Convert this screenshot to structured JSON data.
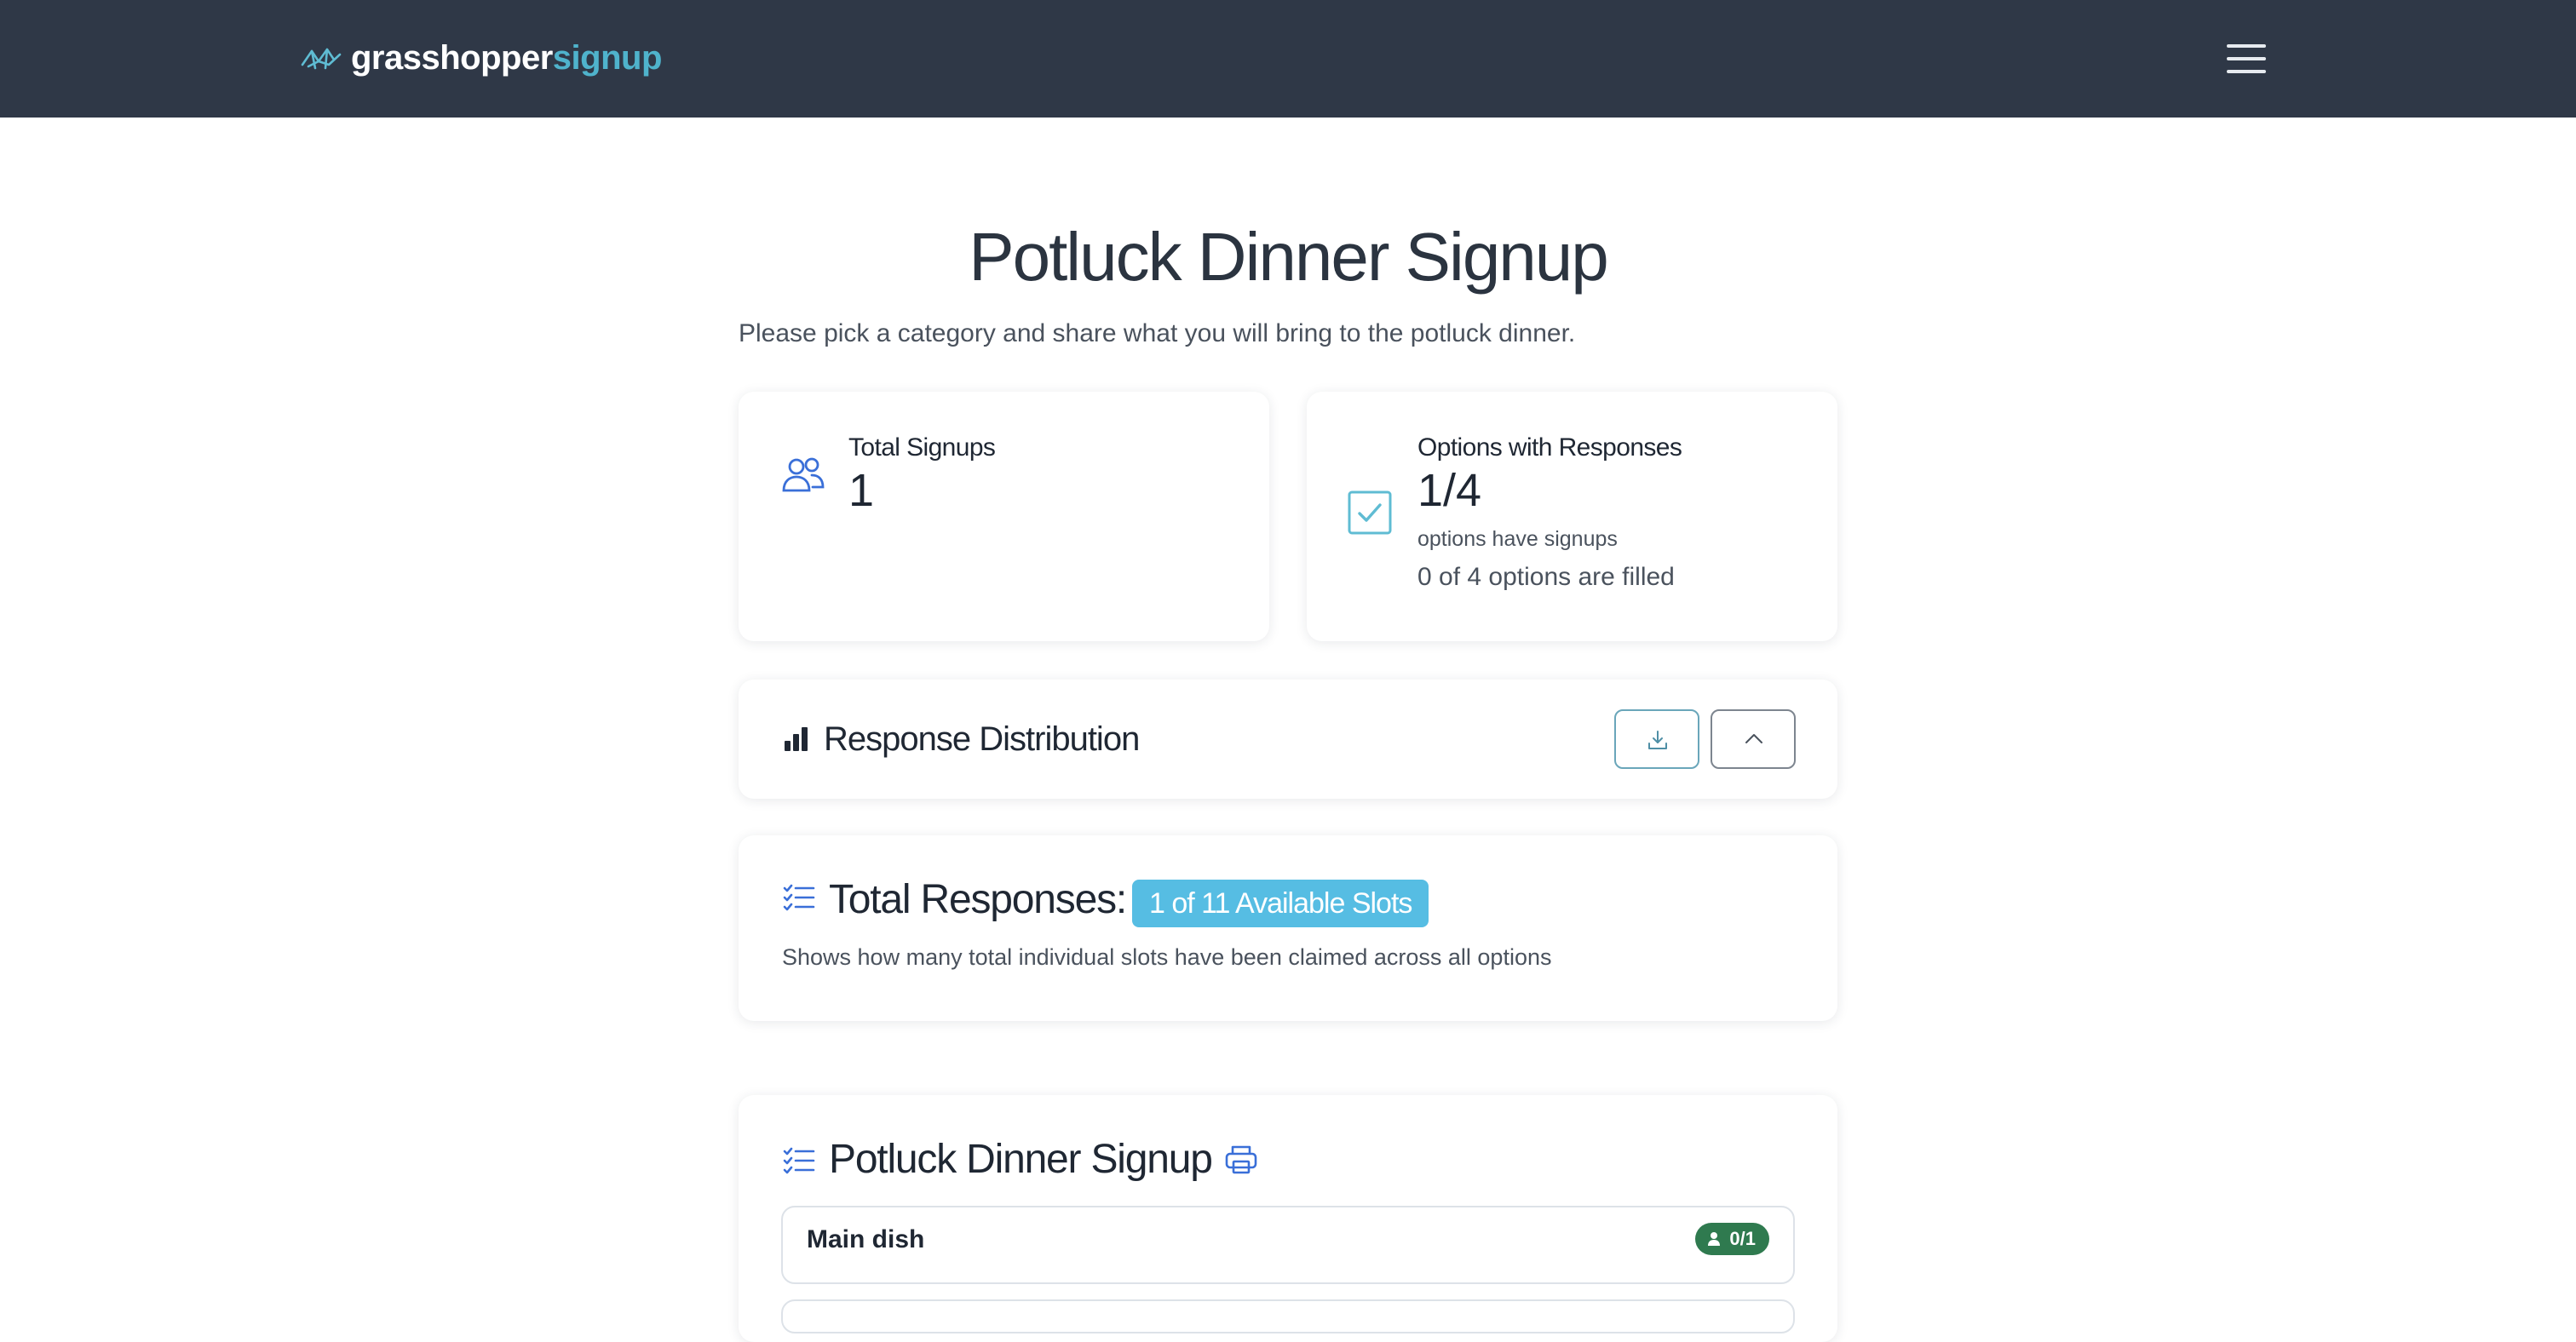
{
  "nav": {
    "brand_part1": "grasshopper",
    "brand_part2": "signup",
    "menu_icon": "hamburger-icon"
  },
  "header": {
    "title": "Potluck Dinner Signup",
    "description": "Please pick a category and share what you will bring to the potluck dinner."
  },
  "stats": {
    "total_signups": {
      "label": "Total Signups",
      "value": "1",
      "icon": "users-icon"
    },
    "options_with_responses": {
      "label": "Options with Responses",
      "value": "1/4",
      "sub": "options have signups",
      "filled": "0 of 4 options are filled",
      "icon": "checkbox-icon"
    }
  },
  "distribution": {
    "title": "Response Distribution",
    "icon": "bar-chart-icon",
    "download_icon": "download-icon",
    "collapse_icon": "chevron-up-icon"
  },
  "responses": {
    "title": "Total Responses:",
    "badge": "1 of 11 Available Slots",
    "explanation": "Shows how many total individual slots have been claimed across all options",
    "icon": "checklist-icon"
  },
  "signup_list": {
    "title": "Potluck Dinner Signup",
    "icon": "checklist-icon",
    "print_icon": "printer-icon",
    "items": [
      {
        "name": "Main dish",
        "count": "0/1"
      }
    ]
  },
  "colors": {
    "navbar": "#2f3847",
    "brand_accent": "#4fb3cc",
    "icon_blue": "#3a6fd8",
    "badge_cyan": "#56bde3",
    "count_green": "#2f7a4f"
  }
}
